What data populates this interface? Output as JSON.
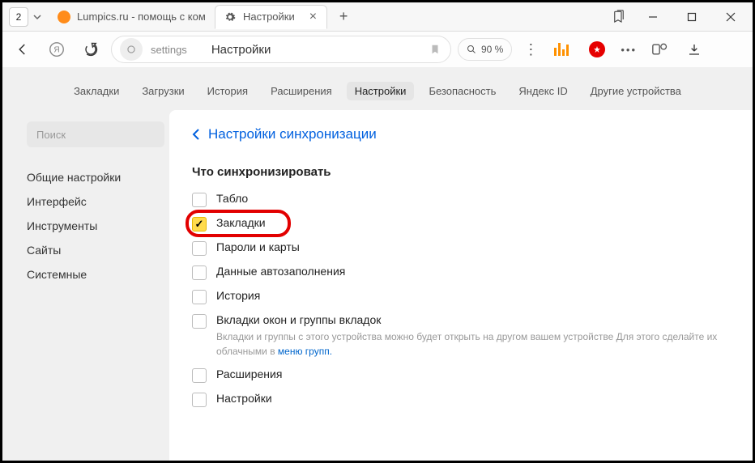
{
  "titlebar": {
    "tab_counter": "2",
    "tab_inactive": {
      "label": "Lumpics.ru - помощь с ком"
    },
    "tab_active": {
      "label": "Настройки"
    }
  },
  "toolbar": {
    "addr_host": "settings",
    "addr_title": "Настройки",
    "zoom_text": "90 %"
  },
  "topnav": [
    "Закладки",
    "Загрузки",
    "История",
    "Расширения",
    "Настройки",
    "Безопасность",
    "Яндекс ID",
    "Другие устройства"
  ],
  "topnav_active_index": 4,
  "sidebar": {
    "search_placeholder": "Поиск",
    "items": [
      "Общие настройки",
      "Интерфейс",
      "Инструменты",
      "Сайты",
      "Системные"
    ]
  },
  "panel": {
    "breadcrumb": "Настройки синхронизации",
    "section_title": "Что синхронизировать",
    "sync_items": [
      {
        "label": "Табло",
        "checked": false
      },
      {
        "label": "Закладки",
        "checked": true,
        "highlight": true
      },
      {
        "label": "Пароли и карты",
        "checked": false
      },
      {
        "label": "Данные автозаполнения",
        "checked": false
      },
      {
        "label": "История",
        "checked": false
      },
      {
        "label": "Вкладки окон и группы вкладок",
        "checked": false,
        "sub": "Вкладки и группы с этого устройства можно будет открыть на другом вашем устройстве Для этого сделайте их облачными в ",
        "sub_link": "меню групп."
      },
      {
        "label": "Расширения",
        "checked": false
      },
      {
        "label": "Настройки",
        "checked": false
      }
    ]
  }
}
